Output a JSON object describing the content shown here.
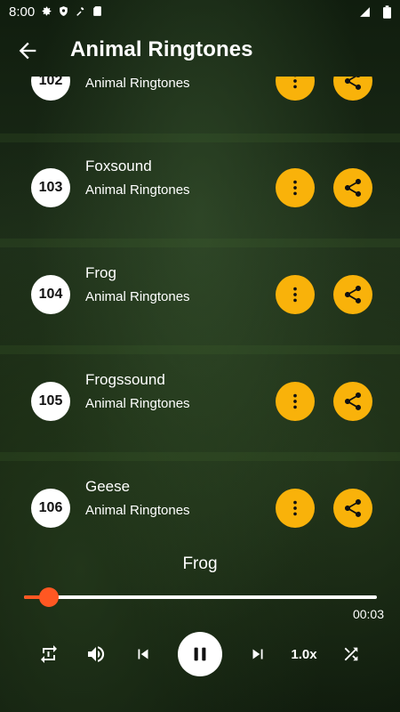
{
  "status": {
    "time": "8:00"
  },
  "appbar": {
    "title": "Animal Ringtones"
  },
  "list": [
    {
      "number": "102",
      "name": "",
      "subtitle": "Animal Ringtones"
    },
    {
      "number": "103",
      "name": "Foxsound",
      "subtitle": "Animal Ringtones"
    },
    {
      "number": "104",
      "name": "Frog",
      "subtitle": "Animal Ringtones"
    },
    {
      "number": "105",
      "name": "Frogssound",
      "subtitle": "Animal Ringtones"
    },
    {
      "number": "106",
      "name": "Geese",
      "subtitle": "Animal Ringtones"
    }
  ],
  "player": {
    "now_playing": "Frog",
    "elapsed": "00:03",
    "progress": 0.07,
    "speed": "1.0x"
  },
  "colors": {
    "accent": "#f9b20a",
    "progress": "#ff5722"
  }
}
